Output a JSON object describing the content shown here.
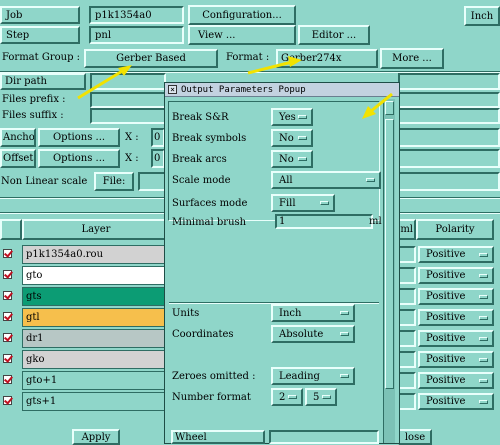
{
  "top": {
    "job_label": "Job",
    "job_value": "p1k1354a0",
    "configuration_button": "Configuration...",
    "inch_button": "Inch",
    "step_label": "Step",
    "step_value": "pnl",
    "view_button": "View ...",
    "editor_button": "Editor ...",
    "format_group_label": "Format Group :",
    "format_group_value": "Gerber Based",
    "format_label": "Format :",
    "format_value": "Gerber274x",
    "more_button": "More ...",
    "dir_path_label": "Dir path",
    "files_prefix_label": "Files prefix :",
    "files_suffix_label": "Files suffix :",
    "anchor_label": "Anchor",
    "anchor_options_button": "Options ...",
    "anchor_x_label": "X :",
    "anchor_x_value": "0",
    "offset_label": "Offset",
    "offset_options_button": "Options ...",
    "offset_x_label": "X :",
    "offset_x_value": "0",
    "nonlinear_label": "Non Linear scale",
    "file_button": "File:"
  },
  "table": {
    "layer_header": "Layer",
    "ml_header": "ml",
    "polarity_header": "Polarity",
    "rows": [
      {
        "layer": "p1k1354a0.rou",
        "polarity": "Positive",
        "color": "#d2d2d2"
      },
      {
        "layer": "gto",
        "polarity": "Positive",
        "color": "#ffffff"
      },
      {
        "layer": "gts",
        "polarity": "Positive",
        "color": "#0c9c74"
      },
      {
        "layer": "gtl",
        "polarity": "Positive",
        "color": "#f6bf4c"
      },
      {
        "layer": "dr1",
        "polarity": "Positive",
        "color": "#b7c7c5"
      },
      {
        "layer": "gko",
        "polarity": "Positive",
        "color": "#d2d2d2"
      },
      {
        "layer": "gto+1",
        "polarity": "Positive",
        "color": "#8fd6c9"
      },
      {
        "layer": "gts+1",
        "polarity": "Positive",
        "color": "#8fd6c9"
      }
    ],
    "apply_button": "Apply",
    "close_button": "lose"
  },
  "popup": {
    "title": "Output Parameters Popup",
    "break_sr_label": "Break S&R",
    "break_sr_value": "Yes",
    "break_symbols_label": "Break symbols",
    "break_symbols_value": "No",
    "break_arcs_label": "Break arcs",
    "break_arcs_value": "No",
    "scale_mode_label": "Scale mode",
    "scale_mode_value": "All",
    "surfaces_mode_label": "Surfaces mode",
    "surfaces_mode_value": "Fill",
    "minimal_brush_label": "Minimal brush",
    "minimal_brush_value": "1",
    "minimal_brush_unit": "ml",
    "units_label": "Units",
    "units_value": "Inch",
    "coordinates_label": "Coordinates",
    "coordinates_value": "Absolute",
    "zeroes_label": "Zeroes omitted :",
    "zeroes_value": "Leading",
    "number_format_label": "Number format",
    "number_format_int": "2",
    "number_format_dec": "5",
    "wheel_label": "Wheel"
  },
  "colors": {
    "background": "#8fd6c9",
    "annotation_arrow": "#f2e200",
    "checkbox_mark": "#c01020"
  }
}
